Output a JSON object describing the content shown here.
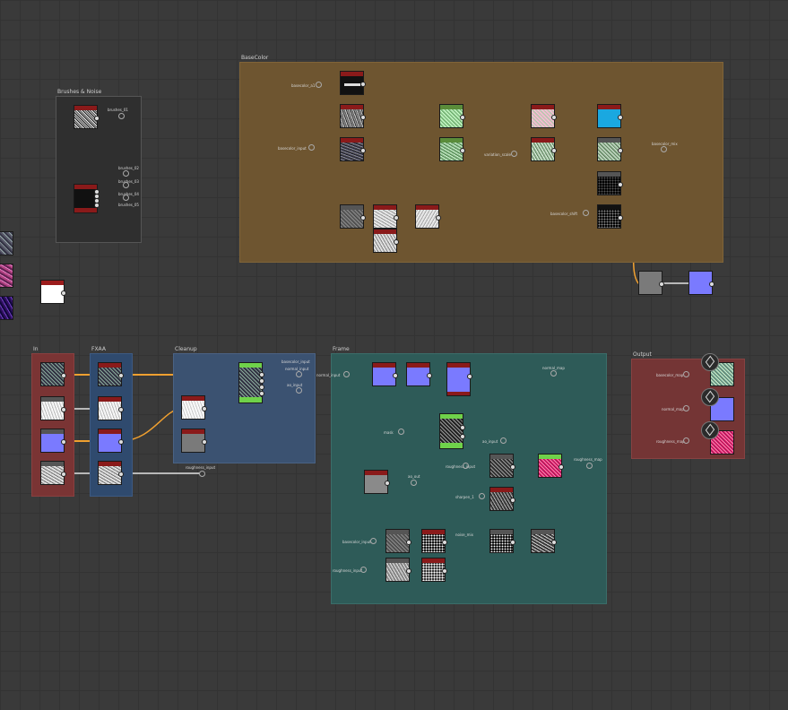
{
  "colors": {
    "wire_orange": "#f0a030",
    "wire_gray": "#b8b8b8",
    "frame_basecolor": "#6e5530",
    "frame_brushes": "#2f2f2f",
    "frame_in": "#7a3434",
    "frame_fxaa": "#2f4a6e",
    "frame_cleanup": "#3b5271",
    "frame_frame": "#2e5b58",
    "frame_output": "#743535"
  },
  "frames": {
    "brushes": {
      "title": "Brushes & Noise"
    },
    "basecolor": {
      "title": "BaseColor"
    },
    "in": {
      "title": "In"
    },
    "fxaa": {
      "title": "FXAA"
    },
    "cleanup": {
      "title": "Cleanup"
    },
    "frame": {
      "title": "Frame"
    },
    "output": {
      "title": "Output"
    }
  },
  "labels": {
    "bc_in_top": "basecolor_a1",
    "bc_in_mid": "basecolor_input",
    "bc_mid_var": "variation_scale",
    "bc_lower_var": "basecolor_shift",
    "bc_out": "basecolor_mix",
    "br_out_1": "brushes_01",
    "br_out_2": "brushes_02",
    "br_out_3": "brushes_03",
    "br_out_4": "brushes_04",
    "br_out_5": "brushes_05",
    "cl_out_1": "basecolor_input",
    "cl_out_2": "normal_input",
    "cl_out_3": "ao_input",
    "fx_lower": "roughness_input",
    "fr_in": "normal_input",
    "fr_out_top": "normal_map",
    "fr_mid_in": "mask",
    "fr_mid_var": "ao_input",
    "fr_ms": "roughness_input",
    "fr_rout": "roughness_map",
    "fr_ao": "ao_out",
    "fr_s1": "sharpen_1",
    "fr_lower1": "basecolor_input",
    "fr_lower2": "roughness_input",
    "fr_noise": "noise_mix",
    "out_1": "basecolor_map",
    "out_2": "normal_map",
    "out_3": "roughness_map"
  },
  "icons": {
    "output_node_icon": "3d-cube-icon"
  }
}
